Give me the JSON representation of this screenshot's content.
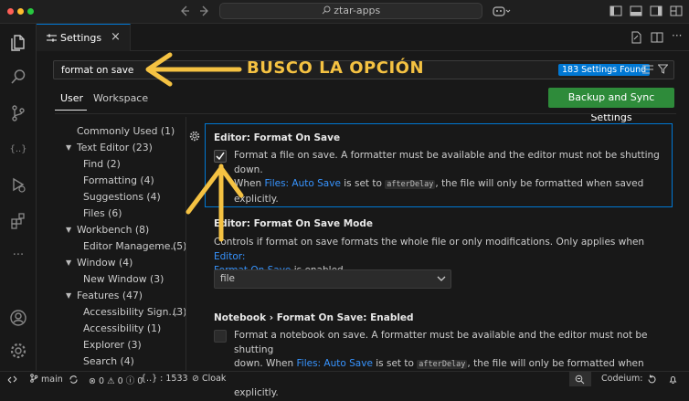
{
  "titlebar": {
    "command_center": "ztar-apps",
    "colors": {
      "close": "#ff5f57",
      "minimize": "#febc2e",
      "zoom": "#28c840"
    }
  },
  "activity_bar": {
    "icons": [
      "files-icon",
      "search-icon",
      "source-control-icon",
      "json-icon",
      "debug-icon",
      "extensions-icon",
      "more-icon",
      "account-icon",
      "gear-icon"
    ],
    "more_label": "···"
  },
  "tab": {
    "label": "Settings",
    "close": "×"
  },
  "search": {
    "value": "format on save",
    "results": "183 Settings Found"
  },
  "scopes": {
    "user": "User",
    "workspace": "Workspace"
  },
  "sync_button": "Backup and Sync Settings",
  "toc": [
    {
      "label": "Commonly Used (1)"
    },
    {
      "label": "Text Editor (23)",
      "expanded": true
    },
    {
      "label": "Find (2)"
    },
    {
      "label": "Formatting (4)"
    },
    {
      "label": "Suggestions (4)"
    },
    {
      "label": "Files (6)"
    },
    {
      "label": "Workbench (8)",
      "expanded": true
    },
    {
      "label": "Editor Manageme...",
      "count": "(5)"
    },
    {
      "label": "Window (4)",
      "expanded": true
    },
    {
      "label": "New Window (3)"
    },
    {
      "label": "Features (47)",
      "expanded": true
    },
    {
      "label": "Accessibility Sign...",
      "count": "(3)"
    },
    {
      "label": "Accessibility (1)"
    },
    {
      "label": "Explorer (3)"
    },
    {
      "label": "Search (4)"
    }
  ],
  "settings": {
    "format_on_save": {
      "title_prefix": "Editor: ",
      "title": "Format On Save",
      "desc1": "Format a file on save. A formatter must be available and the editor must not be shutting down.",
      "desc2_a": "When ",
      "desc2_link": "Files: Auto Save",
      "desc2_b": " is set to ",
      "desc2_code": "afterDelay",
      "desc2_c": ", the file will only be formatted when saved",
      "desc3": "explicitly.",
      "checked": true
    },
    "format_on_save_mode": {
      "title_prefix": "Editor: ",
      "title": "Format On Save Mode",
      "desc_a": "Controls if format on save formats the whole file or only modifications. Only applies when ",
      "desc_link1": "Editor:",
      "desc_link2": "Format On Save",
      "desc_b": " is enabled.",
      "value": "file"
    },
    "notebook_format_on_save": {
      "title_prefix": "Notebook › ",
      "title": "Format On Save: Enabled",
      "desc1": "Format a notebook on save. A formatter must be available and the editor must not be shutting",
      "desc2_a": "down. When ",
      "desc2_link": "Files: Auto Save",
      "desc2_b": " is set to ",
      "desc2_code": "afterDelay",
      "desc2_c": ", the file will only be formatted when saved",
      "desc3": "explicitly.",
      "checked": false
    }
  },
  "statusbar": {
    "branch": "main",
    "errors": "0",
    "warnings": "0",
    "info": "0",
    "position": "{..} : 1533",
    "cloak": "Cloak",
    "codeium": "Codeium:"
  },
  "annotation": {
    "text": "BUSCO LA OPCIÓN",
    "color": "#f5c242"
  }
}
